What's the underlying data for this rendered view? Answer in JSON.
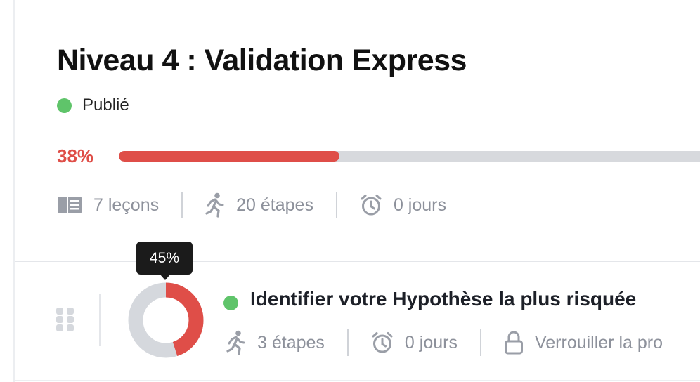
{
  "module": {
    "title": "Niveau 4 : Validation Express",
    "status_label": "Publié",
    "status_color": "#5fc46a",
    "progress": {
      "value": 0.38,
      "label": "38%",
      "color": "#df4e48"
    },
    "stats": {
      "lessons": "7 leçons",
      "steps": "20 étapes",
      "days": "0 jours"
    }
  },
  "lesson": {
    "title": "Identifier votre Hypothèse la plus risquée",
    "status_color": "#5fc46a",
    "progress": {
      "value": 0.45,
      "label": "45%",
      "color": "#df4e48",
      "track_color": "#d5d8dd"
    },
    "stats": {
      "steps": "3 étapes",
      "days": "0 jours",
      "lock_label": "Verrouiller la pro"
    }
  },
  "icons": {
    "lessons": "book-icon",
    "steps": "walking-person-icon",
    "days": "alarm-clock-icon",
    "lock": "lock-icon",
    "drag": "drag-handle-icon"
  }
}
